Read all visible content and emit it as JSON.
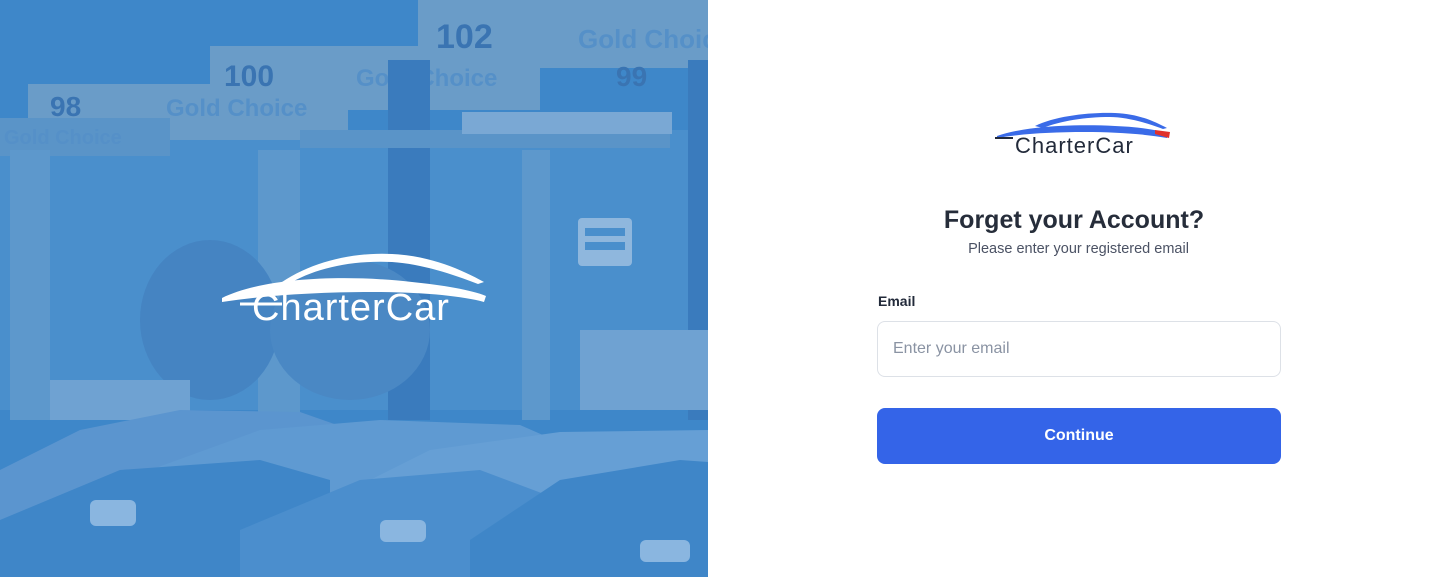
{
  "hero": {
    "brand": "CharterCar",
    "background": "parking-lot-photo",
    "overlay_color": "#3d86c9",
    "sign_numbers": [
      "102",
      "100",
      "98",
      "99"
    ],
    "sign_text": [
      "Gold Choice",
      "Gold Choice",
      "Gold Choice",
      "Gold Choice",
      "Gold Choice"
    ]
  },
  "form": {
    "logo_text": "CharterCar",
    "title": "Forget your Account?",
    "subtitle": "Please enter your registered email",
    "email_label": "Email",
    "email_placeholder": "Enter your email",
    "email_value": "",
    "submit_label": "Continue"
  },
  "colors": {
    "primary": "#3464e8",
    "logo_blue": "#3a6be8",
    "logo_red": "#e0312b",
    "text_dark": "#262d3a"
  }
}
